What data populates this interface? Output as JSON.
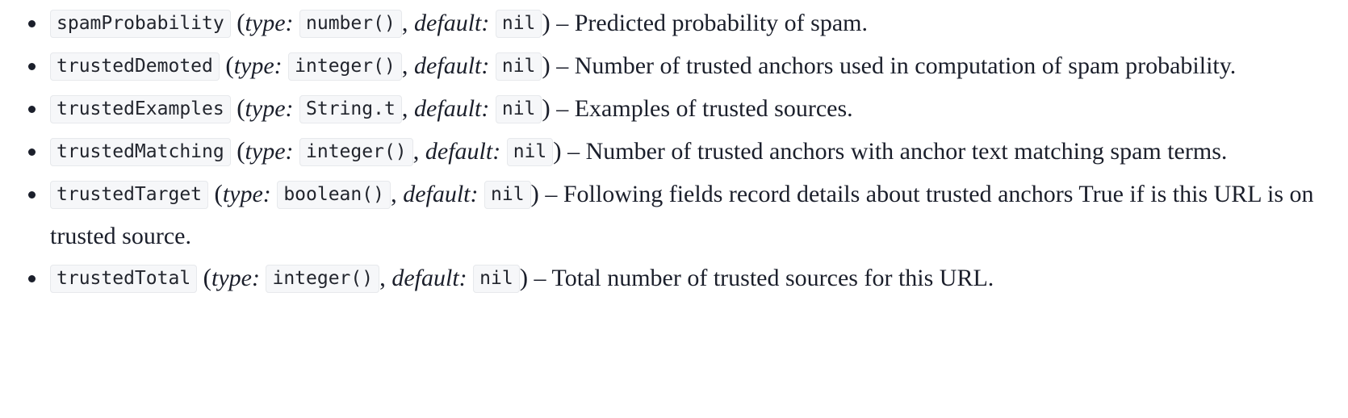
{
  "page": {
    "kind": "api-reference-field-list",
    "bullet_glyph": "•",
    "colors": {
      "text": "#1b1f2b",
      "code_background": "#f6f7f9",
      "code_border": "#e7e9ec",
      "page_background": "#ffffff"
    },
    "labels": {
      "type_label": "type:",
      "default_label": "default:",
      "open_paren": "(",
      "close_paren": ")",
      "comma": ",",
      "dash": "–"
    }
  },
  "fields": [
    {
      "name": "spamProbability",
      "type": "number()",
      "default": "nil",
      "description": "Predicted probability of spam."
    },
    {
      "name": "trustedDemoted",
      "type": "integer()",
      "default": "nil",
      "description": "Number of trusted anchors used in computation of spam probability."
    },
    {
      "name": "trustedExamples",
      "type": "String.t",
      "default": "nil",
      "description": "Examples of trusted sources."
    },
    {
      "name": "trustedMatching",
      "type": "integer()",
      "default": "nil",
      "description": "Number of trusted anchors with anchor text matching spam terms."
    },
    {
      "name": "trustedTarget",
      "type": "boolean()",
      "default": "nil",
      "description": "Following fields record details about trusted anchors True if is this URL is on trusted source."
    },
    {
      "name": "trustedTotal",
      "type": "integer()",
      "default": "nil",
      "description": "Total number of trusted sources for this URL."
    }
  ]
}
